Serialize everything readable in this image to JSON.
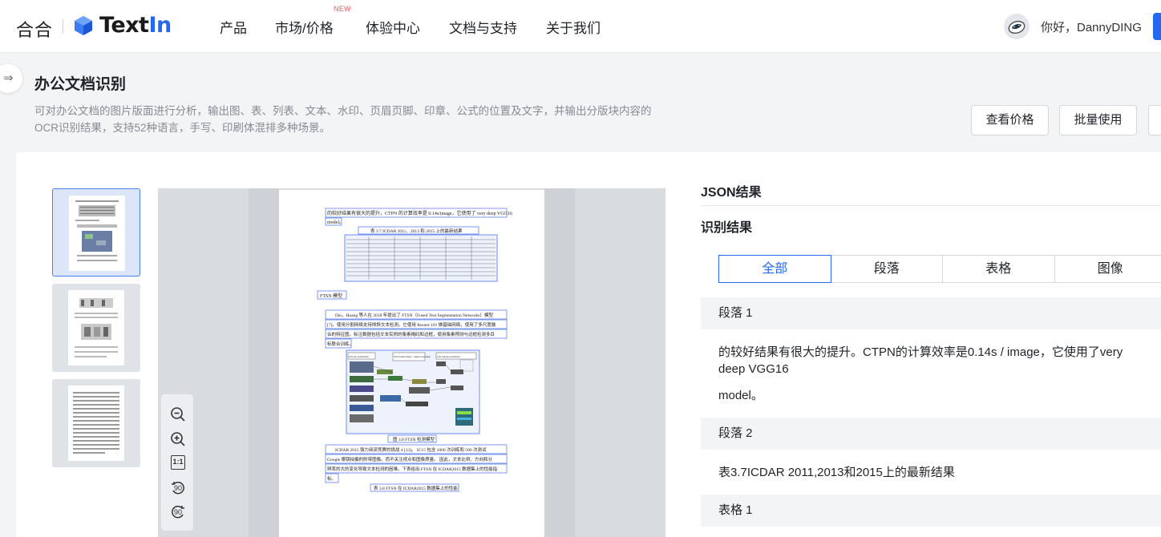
{
  "nav": {
    "logo_hehe": "合合",
    "logo_text_a": "Text",
    "logo_text_b": "In",
    "items": [
      "产品",
      "市场/价格",
      "体验中心",
      "文档与支持",
      "关于我们"
    ],
    "new_badge": "NEW",
    "greeting": "你好，DannyDING"
  },
  "page": {
    "title": "办公文档识别",
    "desc_line1": "可对办公文档的图片版面进行分析，输出图、表、列表、文本、水印、页眉页脚、印章、公式的位置及文字，并输出分版块内容的",
    "desc_line2": "OCR识别结果，支持52种语言，手写、印刷体混排多种场景。",
    "btn_price": "查看价格",
    "btn_batch": "批量使用"
  },
  "result": {
    "json_title": "JSON结果",
    "recog_title": "识别结果",
    "tabs": [
      "全部",
      "段落",
      "表格",
      "图像"
    ],
    "active_tab": "全部",
    "sections": [
      {
        "head": "段落 1",
        "lines": [
          "的较好结果有很大的提升。CTPN的计算效率是0.14s / image，它使用了very deep VGG16",
          "model。"
        ]
      },
      {
        "head": "段落 2",
        "lines": [
          "表3.7ICDAR 2011,2013和2015上的最新结果"
        ]
      },
      {
        "head": "表格 1",
        "lines": []
      }
    ]
  },
  "doc": {
    "l1": "的较好结果有很大的提升，CTPN 的计算效率是 0.14s/image，它使用了 very deep VGG16",
    "l2": "model。",
    "table_caption": "表 3.7 ICDAR 2011、2013 和 2015 上的最新结果",
    "heading": "FTSN 模型",
    "p1a": "Dai，Huang 等人在 2018 年提出了 FTSN（Fused Text Segmentation Networks）模型",
    "p1b": "[7]。使用分割网络支持倾斜文本检测。它使用 Resnet-101 做基础网络，使用了多尺度融",
    "p1c": "合的特征图。标注数据包括文本实例的像素掩码和边框，使用像素预测与边框检测多目",
    "p1d": "标联合训练。",
    "fig_caption": "图 3.8 FTSN 检测模型",
    "p2a": "ICDAR 2015 强力阅读竞赛的挑战 4 [13]。 IC15 包含 1000 次训练和 500 次测试",
    "p2b": "Google 眼镜拍摄的附带图像。而不关注视点和图像质量。 因此，文本比例、方向和分",
    "p2c": "辨率的大的变化导致文本检测的困难。下表给出 FTSN 在 ICDAR2015 数据集上的性能指",
    "p2d": "标。",
    "table2_caption": "表 3.8 FTSN 在 ICDAR2015 数据集上的性能",
    "fig_labels": [
      "Text-net architecture",
      "Text feature fusion · region proposing",
      "Text instance prediction"
    ]
  },
  "zoom": {
    "fit_label": "1:1",
    "rot_left": "90",
    "rot_right": "90"
  },
  "colors": {
    "accent": "#2468f2",
    "box_outline": "#5b7ff0"
  }
}
